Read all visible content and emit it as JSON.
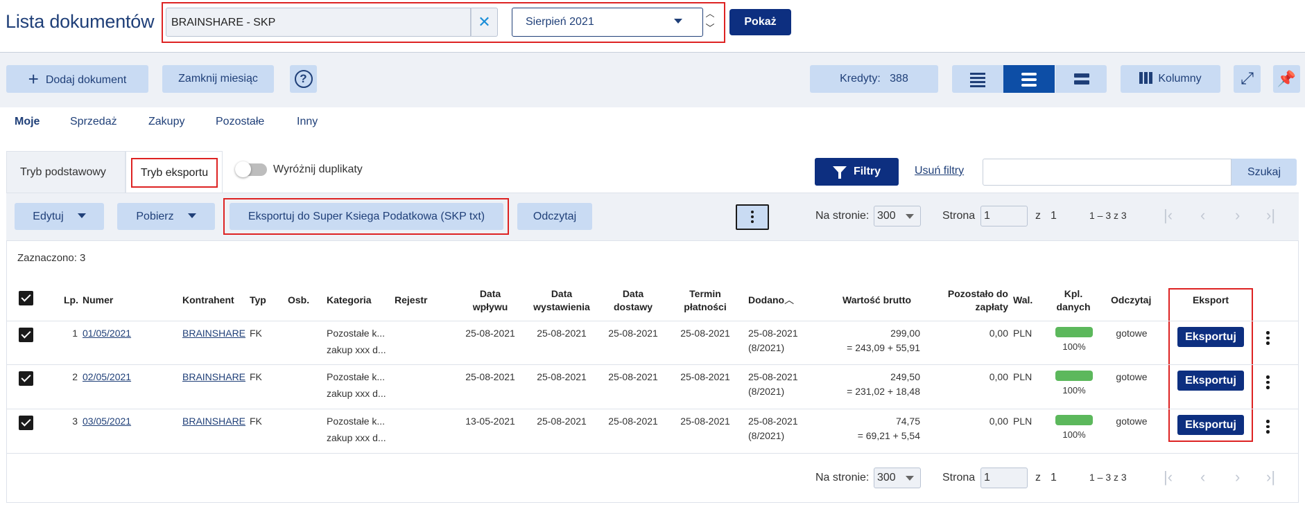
{
  "header": {
    "title": "Lista dokumentów",
    "company": "BRAINSHARE - SKP",
    "month": "Sierpień 2021",
    "show_label": "Pokaż"
  },
  "toolbar": {
    "add_label": "Dodaj dokument",
    "close_month_label": "Zamknij miesiąc",
    "credits_label": "Kredyty:",
    "credits_value": "388",
    "columns_label": "Kolumny"
  },
  "category_tabs": [
    "Moje",
    "Sprzedaż",
    "Zakupy",
    "Pozostałe",
    "Inny"
  ],
  "mode_tabs": {
    "basic": "Tryb podstawowy",
    "export": "Tryb eksportu",
    "duplicates_label": "Wyróżnij duplikaty",
    "filter_label": "Filtry",
    "clear_filters_label": "Usuń filtry",
    "search_label": "Szukaj"
  },
  "actions": {
    "edit": "Edytuj",
    "download": "Pobierz",
    "export_skp": "Eksportuj do Super Ksiega Podatkowa (SKP txt)",
    "read": "Odczytaj"
  },
  "pager": {
    "per_page_label": "Na stronie:",
    "per_page": "300",
    "page_label": "Strona",
    "page": "1",
    "of_label": "z",
    "total_pages": "1",
    "range": "1 – 3 z 3",
    "first": "|‹",
    "prev": "‹",
    "next": "›",
    "last": "›|"
  },
  "selected_text": "Zaznaczono: 3",
  "table": {
    "headers": {
      "lp": "Lp.",
      "numer": "Numer",
      "kontrahent": "Kontrahent",
      "typ": "Typ",
      "osb": "Osb.",
      "kategoria": "Kategoria",
      "rejestr": "Rejestr",
      "data_wplywu_1": "Data",
      "data_wplywu_2": "wpływu",
      "data_wyst_1": "Data",
      "data_wyst_2": "wystawienia",
      "data_dost_1": "Data",
      "data_dost_2": "dostawy",
      "termin_1": "Termin",
      "termin_2": "płatności",
      "dodano": "Dodano",
      "wartosc": "Wartość brutto",
      "pozostalo_1": "Pozostało do",
      "pozostalo_2": "zapłaty",
      "wal": "Wal.",
      "kpl_1": "Kpl.",
      "kpl_2": "danych",
      "odczytaj": "Odczytaj",
      "eksport": "Eksport"
    },
    "rows": [
      {
        "lp": "1",
        "numer": "01/05/2021",
        "kontrahent": "BRAINSHARE",
        "typ": "FK",
        "kategoria_1": "Pozostałe k...",
        "kategoria_2": "zakup xxx d...",
        "data_wplywu": "25-08-2021",
        "data_wyst": "25-08-2021",
        "data_dost": "25-08-2021",
        "termin": "25-08-2021",
        "dodano_1": "25-08-2021",
        "dodano_2": "(8/2021)",
        "wartosc_1": "299,00",
        "wartosc_2": "= 243,09 + 55,91",
        "pozostalo": "0,00",
        "wal": "PLN",
        "kpl": "100%",
        "kpl_fill": 1.0,
        "odczytaj": "gotowe",
        "eksport": "Eksportuj"
      },
      {
        "lp": "2",
        "numer": "02/05/2021",
        "kontrahent": "BRAINSHARE",
        "typ": "FK",
        "kategoria_1": "Pozostałe k...",
        "kategoria_2": "zakup xxx d...",
        "data_wplywu": "25-08-2021",
        "data_wyst": "25-08-2021",
        "data_dost": "25-08-2021",
        "termin": "25-08-2021",
        "dodano_1": "25-08-2021",
        "dodano_2": "(8/2021)",
        "wartosc_1": "249,50",
        "wartosc_2": "= 231,02 + 18,48",
        "pozostalo": "0,00",
        "wal": "PLN",
        "kpl": "100%",
        "kpl_fill": 1.0,
        "odczytaj": "gotowe",
        "eksport": "Eksportuj"
      },
      {
        "lp": "3",
        "numer": "03/05/2021",
        "kontrahent": "BRAINSHARE",
        "typ": "FK",
        "kategoria_1": "Pozostałe k...",
        "kategoria_2": "zakup xxx d...",
        "data_wplywu": "13-05-2021",
        "data_wyst": "25-08-2021",
        "data_dost": "25-08-2021",
        "termin": "25-08-2021",
        "dodano_1": "25-08-2021",
        "dodano_2": "(8/2021)",
        "wartosc_1": "74,75",
        "wartosc_2": "= 69,21 + 5,54",
        "pozostalo": "0,00",
        "wal": "PLN",
        "kpl": "100%",
        "kpl_fill": 1.0,
        "odczytaj": "gotowe",
        "eksport": "Eksportuj"
      }
    ]
  },
  "colors": {
    "accent_dark": "#0d2f80",
    "accent_light": "#c9dbf3",
    "highlight_frame": "#dd2222",
    "progress": "#5cb85c"
  },
  "icons": [
    "close-icon",
    "chevron-down-icon",
    "plus-icon",
    "help-icon",
    "list-view-icon",
    "columns-icon",
    "expand-icon",
    "pin-icon",
    "filter-icon",
    "kebab-icon",
    "checkbox-icon"
  ]
}
